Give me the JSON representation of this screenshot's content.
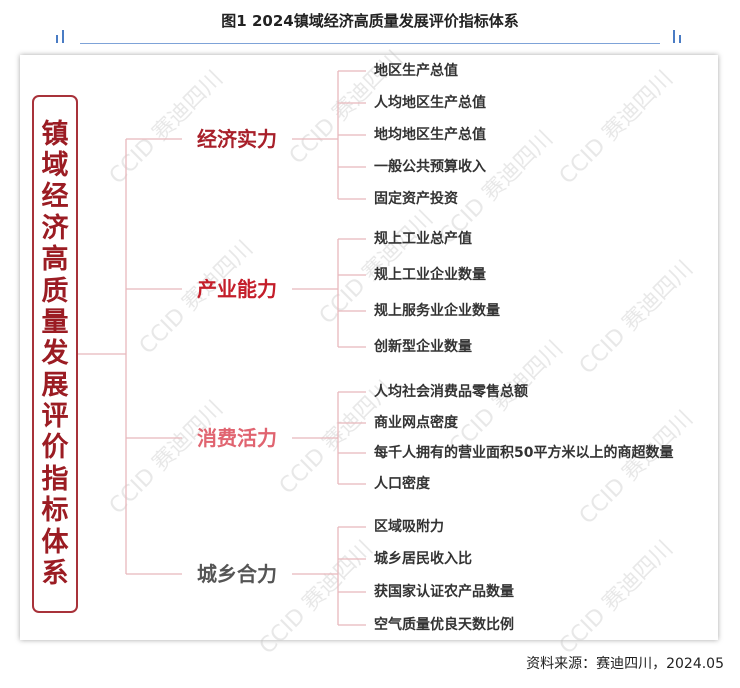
{
  "title": "图1   2024镇域经济高质量发展评价指标体系",
  "root": {
    "label": "镇域经济高质量发展评价指标体系",
    "color": "#9b1c23"
  },
  "categories": [
    {
      "name": "经济实力",
      "color": "#a8202a",
      "items": [
        "地区生产总值",
        "人均地区生产总值",
        "地均地区生产总值",
        "一般公共预算收入",
        "固定资产投资"
      ]
    },
    {
      "name": "产业能力",
      "color": "#c41e2a",
      "items": [
        "规上工业总产值",
        "规上工业企业数量",
        "规上服务业企业数量",
        "创新型企业数量"
      ]
    },
    {
      "name": "消费活力",
      "color": "#e06470",
      "items": [
        "人均社会消费品零售总额",
        "商业网点密度",
        "每千人拥有的营业面积50平方米以上的商超数量",
        "人口密度"
      ]
    },
    {
      "name": "城乡合力",
      "color": "#555555",
      "items": [
        "区域吸附力",
        "城乡居民收入比",
        "获国家认证农产品数量",
        "空气质量优良天数比例"
      ]
    }
  ],
  "watermark": "CCID 赛迪四川",
  "source": "资料来源：赛迪四川，2024.05"
}
